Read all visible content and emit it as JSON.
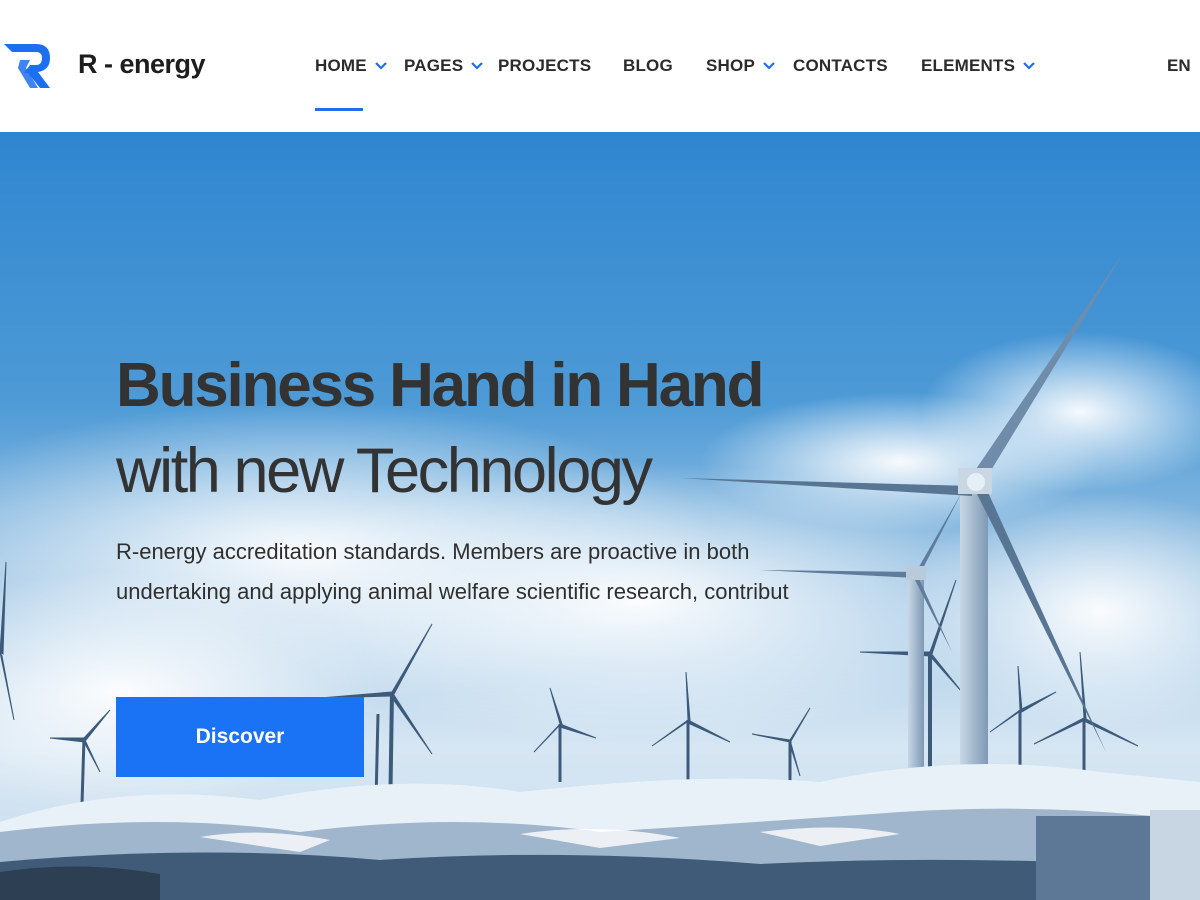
{
  "brand": {
    "name": "R - energy",
    "accent": "#1c6ff0"
  },
  "nav": {
    "items": [
      {
        "label": "HOME",
        "has_dropdown": true,
        "active": true
      },
      {
        "label": "PAGES",
        "has_dropdown": true,
        "active": false
      },
      {
        "label": "PROJECTS",
        "has_dropdown": false,
        "active": false
      },
      {
        "label": "BLOG",
        "has_dropdown": false,
        "active": false
      },
      {
        "label": "SHOP",
        "has_dropdown": true,
        "active": false
      },
      {
        "label": "CONTACTS",
        "has_dropdown": false,
        "active": false
      },
      {
        "label": "ELEMENTS",
        "has_dropdown": true,
        "active": false
      }
    ],
    "language": "EN"
  },
  "hero": {
    "title": "Business Hand in Hand",
    "subtitle": "with new Technology",
    "description": "R-energy accreditation standards. Members are proactive in both undertaking and applying animal welfare scientific research, contribut",
    "button_label": "Discover",
    "button_color": "#1a73f5"
  }
}
